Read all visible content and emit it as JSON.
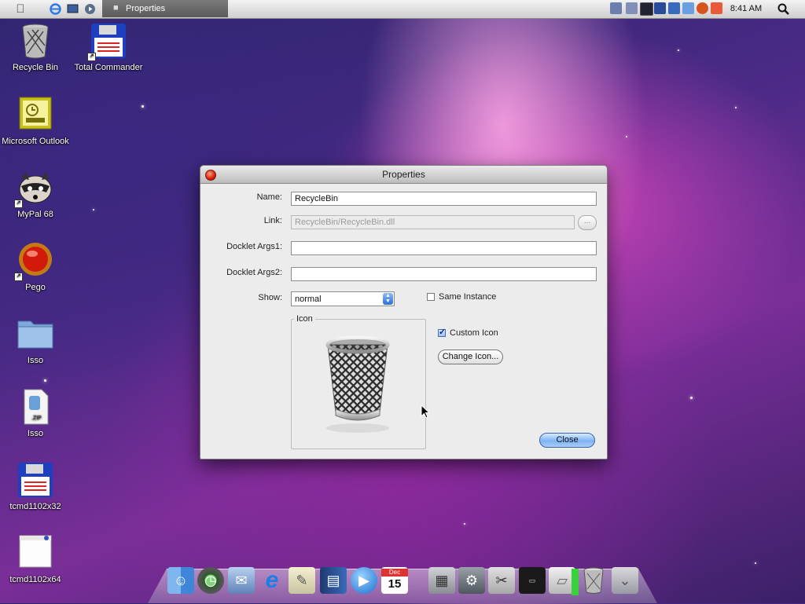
{
  "menubar": {
    "apple_icon": "apple-logo-icon",
    "quicklaunch_icons": [
      "ie-icon",
      "display-icon",
      "media-icon"
    ],
    "task_button_label": "Properties",
    "tray_icons": [
      "network-icon",
      "keyboard-icon",
      "monitor-icon",
      "app-icon",
      "chart-icon",
      "tool-icon",
      "search-tray-icon",
      "settings-icon"
    ],
    "clock": "8:41 AM",
    "spotlight_icon": "spotlight-search-icon"
  },
  "desktop_icons": [
    {
      "label": "Recycle Bin",
      "icon": "trash-bin-icon"
    },
    {
      "label": "Total Commander",
      "icon": "floppy-disk-icon"
    },
    {
      "label": "Microsoft Outlook",
      "icon": "outlook-icon"
    },
    {
      "label": "MyPal 68",
      "icon": "raccoon-icon"
    },
    {
      "label": "Pego",
      "icon": "red-orb-icon"
    },
    {
      "label": "Isso",
      "icon": "folder-icon"
    },
    {
      "label": "Isso",
      "icon": "zip-file-icon"
    },
    {
      "label": "tcmd1102x32",
      "icon": "floppy-disk-icon"
    },
    {
      "label": "tcmd1102x64",
      "icon": "window-icon"
    }
  ],
  "dialog": {
    "title": "Properties",
    "name_label": "Name:",
    "name_value": "RecycleBin",
    "link_label": "Link:",
    "link_value": "RecycleBin/RecycleBin.dll",
    "browse_label": "...",
    "args1_label": "Docklet Args1:",
    "args1_value": "",
    "args2_label": "Docklet Args2:",
    "args2_value": "",
    "show_label": "Show:",
    "show_value": "normal",
    "same_instance_label": "Same Instance",
    "same_instance_checked": false,
    "icon_group_label": "Icon",
    "custom_icon_label": "Custom Icon",
    "custom_icon_checked": true,
    "change_icon_label": "Change Icon...",
    "close_label": "Close"
  },
  "dock": {
    "calendar_month": "Dec",
    "calendar_day": "15",
    "items": [
      "finder-icon",
      "time-machine-icon",
      "mail-icon",
      "internet-explorer-icon",
      "notes-icon",
      "book-icon",
      "quicktime-icon",
      "calendar-icon",
      "calculator-icon",
      "system-prefs-icon",
      "scissors-icon",
      "console-icon",
      "drive-icon",
      "trash-icon",
      "downloads-icon"
    ]
  }
}
